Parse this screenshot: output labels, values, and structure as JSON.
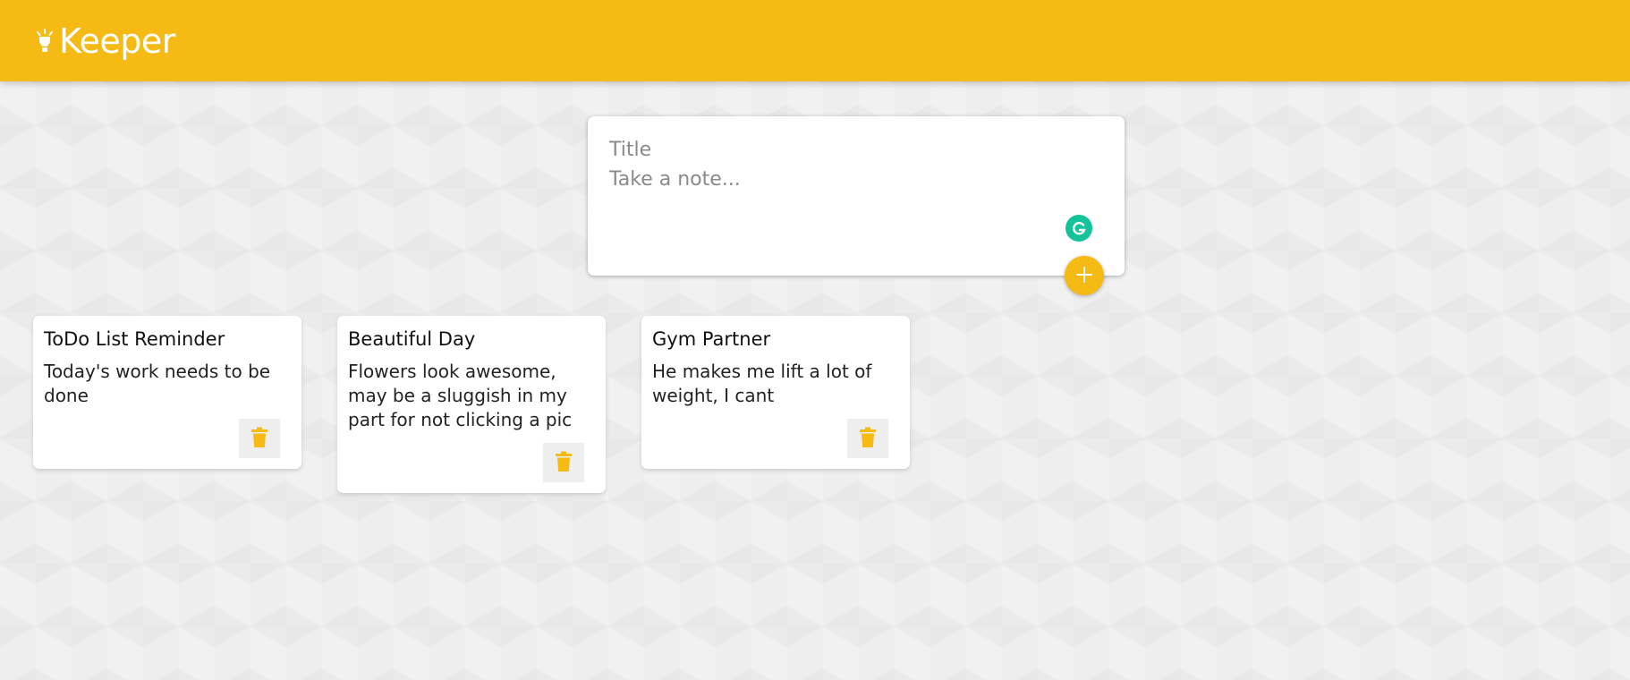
{
  "header": {
    "title": "Keeper",
    "icon": "lightbulb-icon",
    "color": "#f5ba13"
  },
  "create_note": {
    "title_placeholder": "Title",
    "content_placeholder": "Take a note...",
    "add_icon": "plus-icon",
    "grammarly_icon": "grammarly-icon",
    "grammarly_color": "#15c39a"
  },
  "notes": [
    {
      "title": "ToDo List Reminder",
      "content": "Today's work needs to be done",
      "delete_icon": "trash-icon"
    },
    {
      "title": "Beautiful Day",
      "content": "Flowers look awesome, may be a sluggish in my part for not clicking a pic",
      "delete_icon": "trash-icon"
    },
    {
      "title": "Gym Partner",
      "content": "He makes me lift a lot of weight, I cant",
      "delete_icon": "trash-icon"
    }
  ]
}
